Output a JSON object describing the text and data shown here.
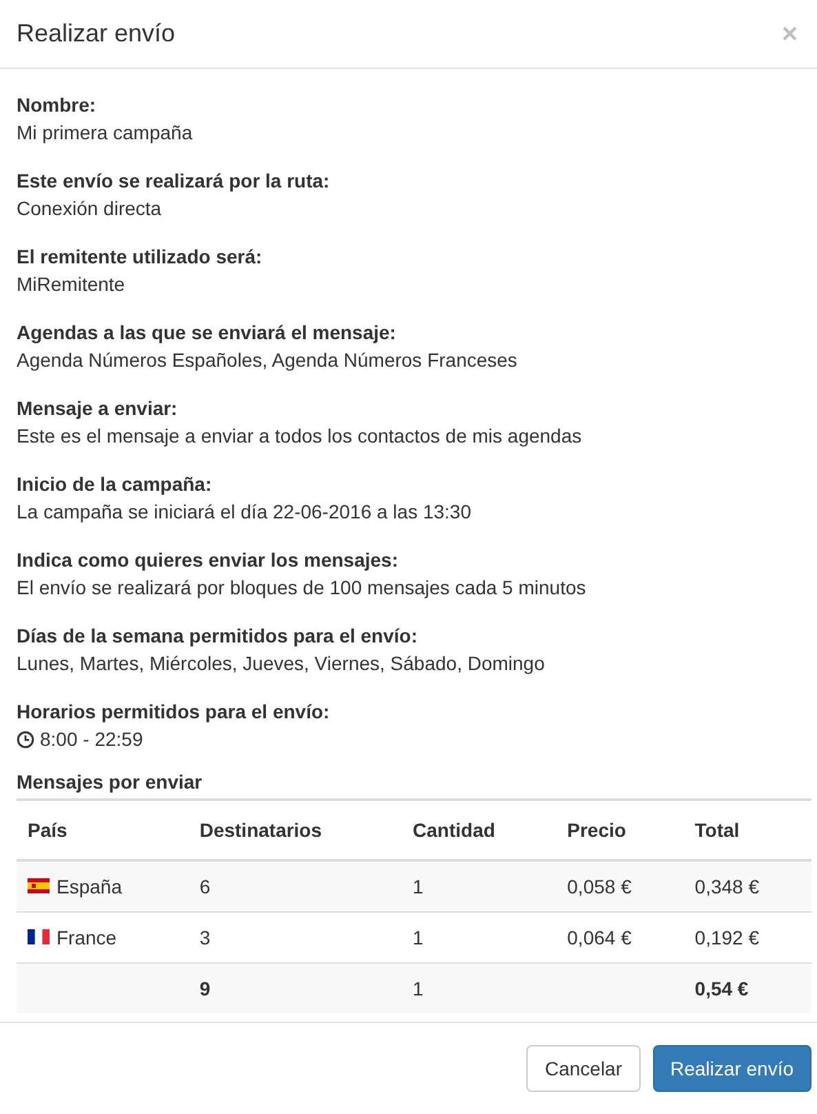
{
  "modal": {
    "title": "Realizar envío",
    "close": "×"
  },
  "fields": [
    {
      "label": "Nombre:",
      "value": "Mi primera campaña",
      "kind": "text"
    },
    {
      "label": "Este envío se realizará por la ruta:",
      "value": "Conexión directa",
      "kind": "text"
    },
    {
      "label": "El remitente utilizado será:",
      "value": "MiRemitente",
      "kind": "text"
    },
    {
      "label": "Agendas a las que se enviará el mensaje:",
      "value": "Agenda Números Españoles, Agenda Números Franceses",
      "kind": "text"
    },
    {
      "label": "Mensaje a enviar:",
      "value": "Este es el mensaje a enviar a todos los contactos de mis agendas",
      "kind": "text"
    },
    {
      "label": "Inicio de la campaña:",
      "value": "La campaña se iniciará el día 22-06-2016 a las 13:30",
      "kind": "text"
    },
    {
      "label": "Indica como quieres enviar los mensajes:",
      "value": "El envío se realizará por bloques de 100 mensajes cada 5 minutos",
      "kind": "text"
    },
    {
      "label": "Días de la semana permitidos para el envío:",
      "value": "Lunes, Martes, Miércoles, Jueves, Viernes, Sábado, Domingo",
      "kind": "text"
    },
    {
      "label": "Horarios permitidos para el envío:",
      "value": "8:00 - 22:59",
      "kind": "time"
    }
  ],
  "table": {
    "title": "Mensajes por enviar",
    "columns": [
      "País",
      "Destinatarios",
      "Cantidad",
      "Precio",
      "Total"
    ],
    "rows": [
      {
        "kind": "es",
        "cells": [
          "España",
          "6",
          "1",
          "0,058 €",
          "0,348 €"
        ]
      },
      {
        "kind": "fr",
        "cells": [
          "France",
          "3",
          "1",
          "0,064 €",
          "0,192 €"
        ]
      }
    ],
    "footer": [
      {
        "kind": "blank"
      },
      {
        "kind": "value",
        "text": "9",
        "bold": true
      },
      {
        "kind": "value",
        "text": "1",
        "bold": false
      },
      {
        "kind": "blank"
      },
      {
        "kind": "value",
        "text": "0,54 €",
        "bold": true
      }
    ]
  },
  "buttons": [
    {
      "label": "Cancelar",
      "kind": "default"
    },
    {
      "label": "Realizar envío",
      "kind": "primary"
    }
  ]
}
